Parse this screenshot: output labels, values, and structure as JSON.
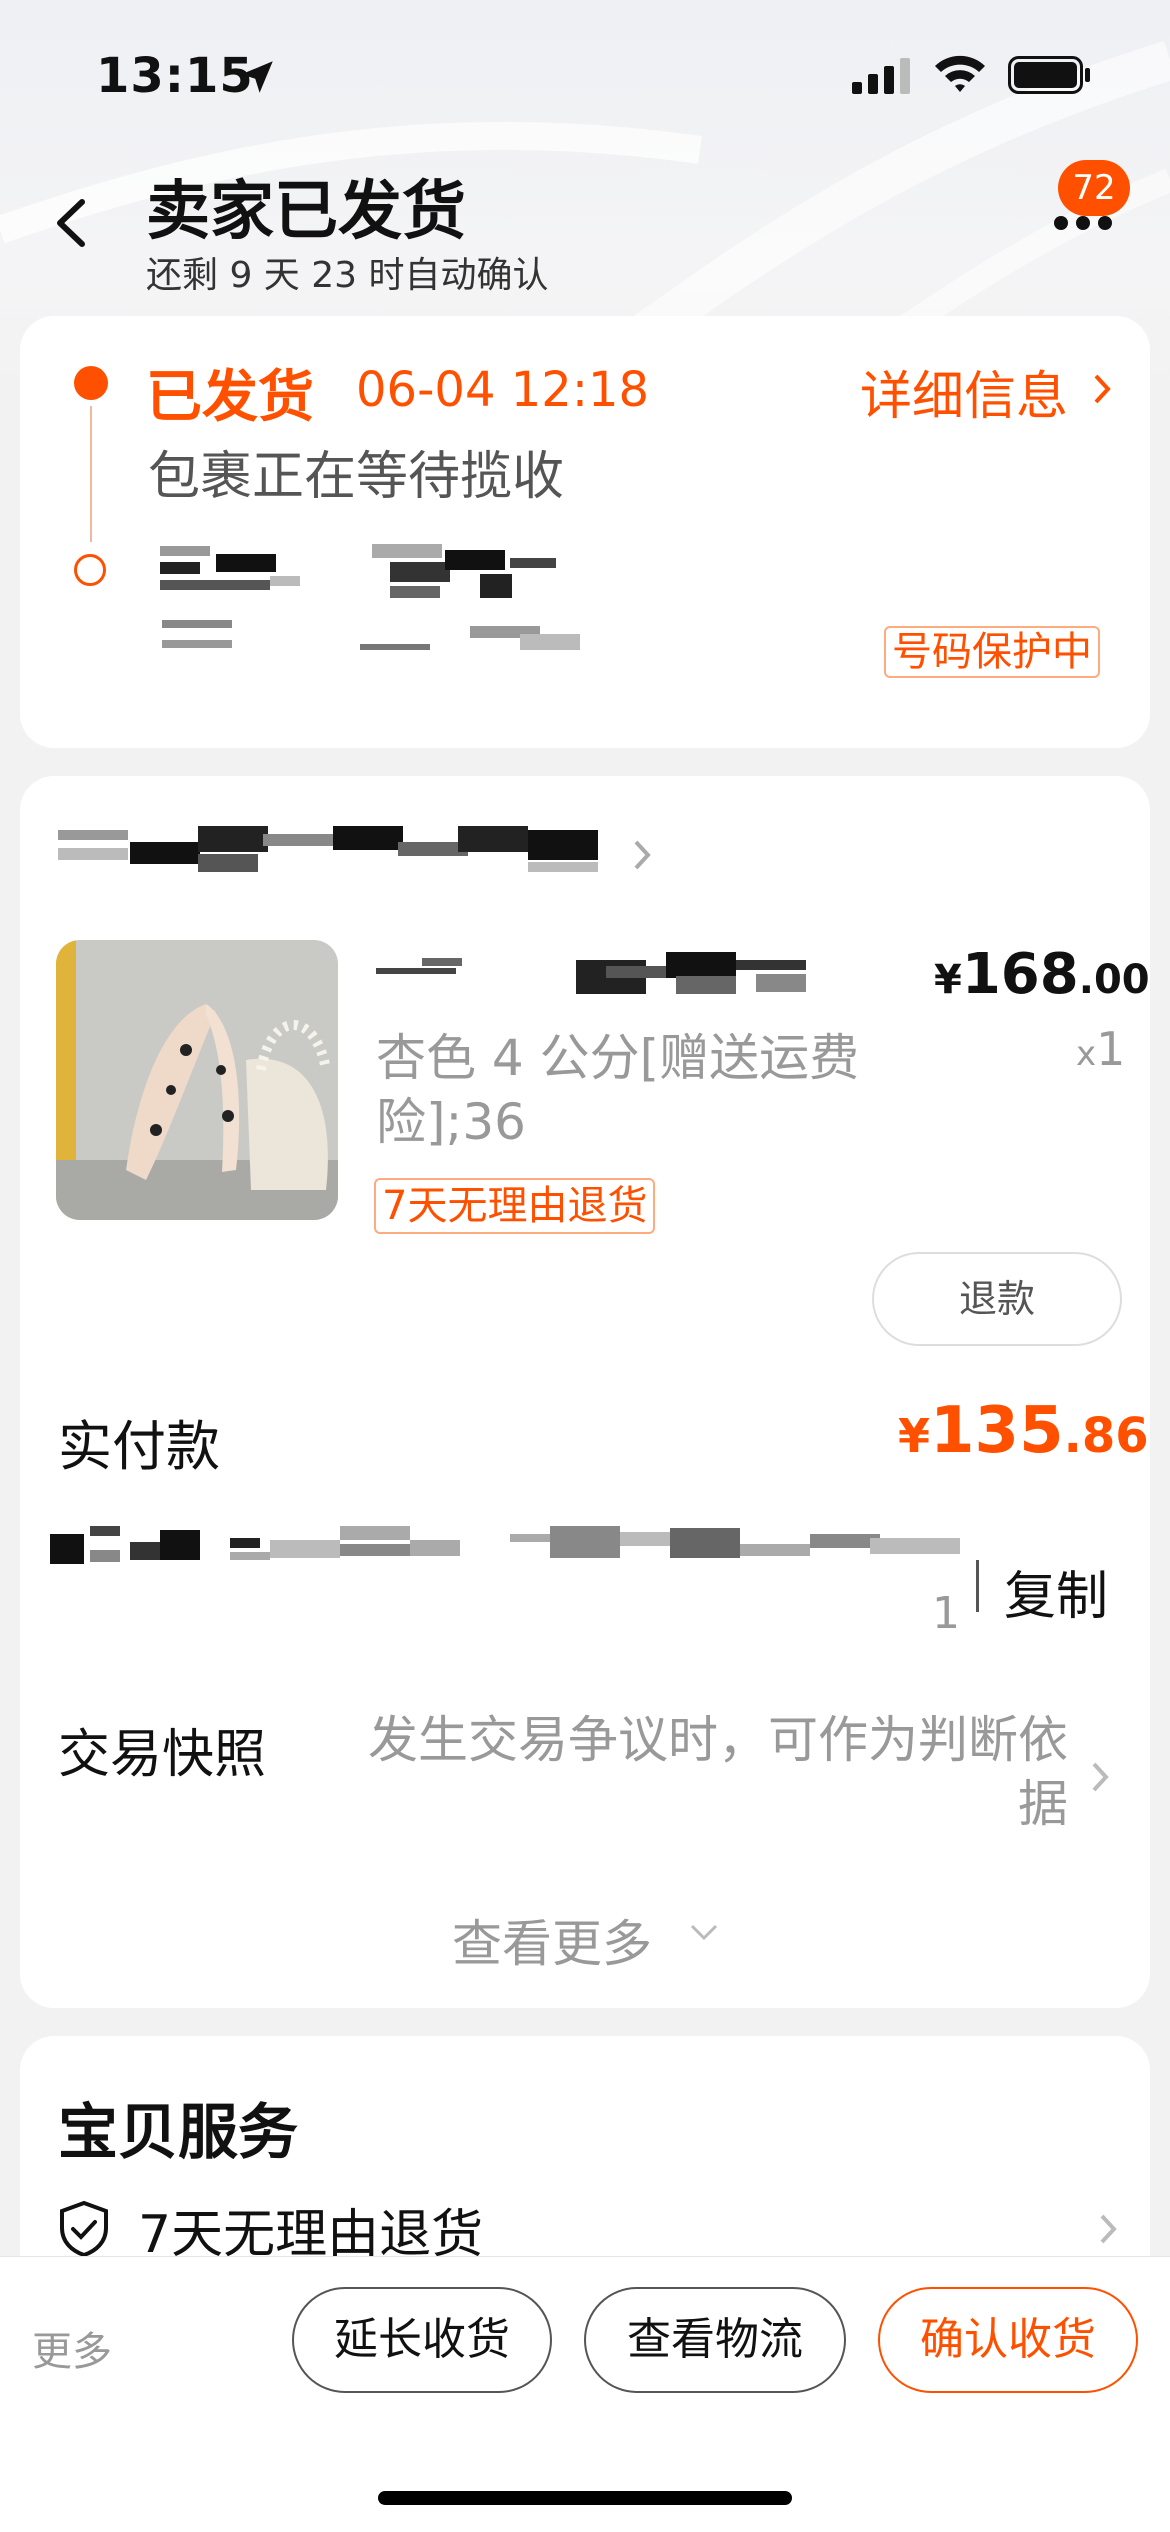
{
  "status_bar": {
    "time": "13:15"
  },
  "nav": {
    "title": "卖家已发货",
    "subtitle": "还剩 9 天 23 时自动确认",
    "badge_count": "72"
  },
  "logistics": {
    "status": "已发货",
    "time": "06-04 12:18",
    "detail_link": "详细信息",
    "description": "包裹正在等待揽收",
    "phone_protection": "号码保护中"
  },
  "order": {
    "product": {
      "price_main": "168",
      "price_decimal": ".00",
      "currency": "¥",
      "quantity_prefix": "x",
      "quantity": "1",
      "sku": "杏色 4 公分[赠送运费险];36",
      "return_policy": "7天无理由退货"
    },
    "refund_label": "退款",
    "paid_label": "实付款",
    "paid_main": "135",
    "paid_decimal": ".86",
    "order_no_tail": "1",
    "copy_label": "复制",
    "snapshot_label": "交易快照",
    "snapshot_desc": "发生交易争议时，可作为判断依据",
    "see_more": "查看更多"
  },
  "service": {
    "title": "宝贝服务",
    "items": [
      {
        "label": "7天无理由退货"
      }
    ]
  },
  "bottom_bar": {
    "more": "更多",
    "extend": "延长收货",
    "track": "查看物流",
    "confirm": "确认收货"
  },
  "colors": {
    "accent": "#ff5000",
    "background": "#f2f2f2",
    "card": "#ffffff"
  }
}
